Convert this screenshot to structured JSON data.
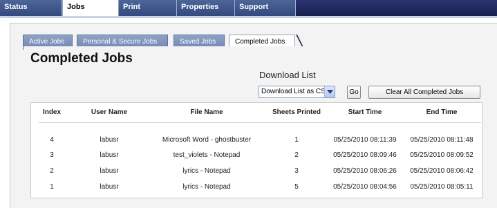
{
  "nav": {
    "tabs": [
      "Status",
      "Jobs",
      "Print",
      "Properties",
      "Support"
    ],
    "active_tab": "Jobs"
  },
  "subtabs": {
    "items": [
      "Active Jobs",
      "Personal & Secure Jobs",
      "Saved Jobs",
      "Completed Jobs"
    ],
    "active": "Completed Jobs"
  },
  "page": {
    "title": "Completed Jobs"
  },
  "download": {
    "label": "Download List",
    "select_value": "Download List as CSV",
    "go_label": "Go",
    "clear_label": "Clear All Completed Jobs"
  },
  "table": {
    "headers": [
      "Index",
      "User Name",
      "File Name",
      "Sheets Printed",
      "Start Time",
      "End Time"
    ],
    "rows": [
      [
        "4",
        "labusr",
        "Microsoft Word - ghostbuster",
        "1",
        "05/25/2010 08:11:39",
        "05/25/2010 08:11:48"
      ],
      [
        "3",
        "labusr",
        "test_violets - Notepad",
        "2",
        "05/25/2010 08:09:46",
        "05/25/2010 08:09:52"
      ],
      [
        "2",
        "labusr",
        "lyrics - Notepad",
        "3",
        "05/25/2010 08:06:26",
        "05/25/2010 08:06:42"
      ],
      [
        "1",
        "labusr",
        "lyrics - Notepad",
        "5",
        "05/25/2010 08:04:56",
        "05/25/2010 08:05:11"
      ]
    ]
  }
}
